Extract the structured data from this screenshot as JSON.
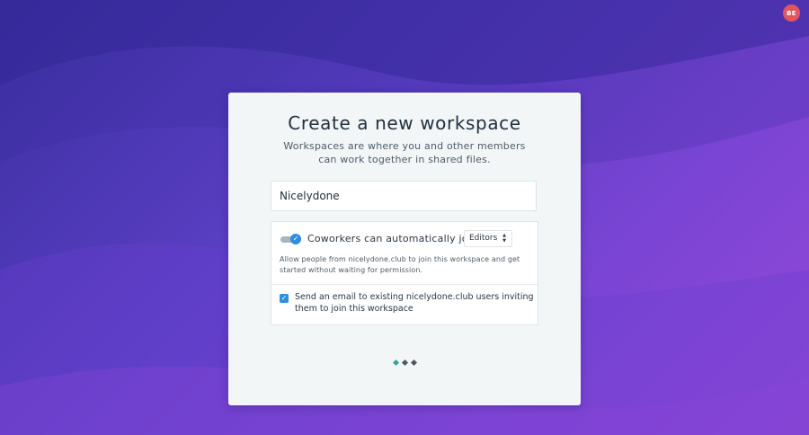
{
  "user": {
    "initials": "BE"
  },
  "dialog": {
    "title": "Create a new workspace",
    "subtitle": "Workspaces are where you and other members can work together in shared files."
  },
  "workspace_name": {
    "value": "Nicelydone",
    "placeholder": ""
  },
  "auto_join": {
    "enabled": true,
    "label": "Coworkers can automatically join as",
    "role_selected": "Editors",
    "description": "Allow people from nicelydone.club to join this workspace and get started without waiting for permission."
  },
  "email_invite": {
    "checked": true,
    "label": "Send an email to existing nicelydone.club users inviting them to join this workspace"
  },
  "progress": {
    "current_step": 1,
    "total_steps": 3
  },
  "colors": {
    "accent": "#2e8fe0",
    "step_active": "#3aa39a",
    "step_inactive": "#4b5a67",
    "avatar": "#e5555f"
  }
}
